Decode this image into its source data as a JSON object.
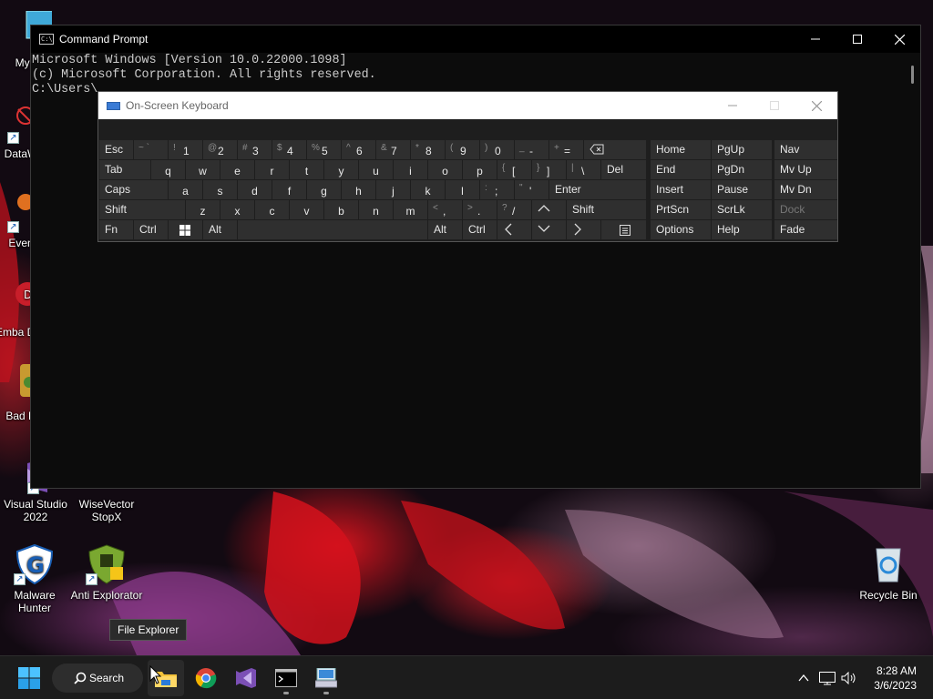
{
  "desktop": {
    "icons": [
      {
        "label": "My Co"
      },
      {
        "label": "DataW"
      },
      {
        "label": "Even"
      },
      {
        "label": "Emba Dev"
      },
      {
        "label": "Bad R"
      },
      {
        "label": "Visual Studio 2022"
      },
      {
        "label": "WiseVector StopX"
      },
      {
        "label": "Malware Hunter"
      },
      {
        "label": "Anti Explorator"
      },
      {
        "label": "Recycle Bin"
      }
    ]
  },
  "cmd": {
    "title": "Command Prompt",
    "lines": [
      "Microsoft Windows [Version 10.0.22000.1098]",
      "(c) Microsoft Corporation. All rights reserved.",
      "",
      "C:\\Users\\"
    ]
  },
  "osk": {
    "title": "On-Screen Keyboard",
    "row1": [
      {
        "label": "Esc"
      },
      {
        "sec": "~ `",
        "pri": ""
      },
      {
        "sec": "!",
        "pri": "1"
      },
      {
        "sec": "@",
        "pri": "2"
      },
      {
        "sec": "#",
        "pri": "3"
      },
      {
        "sec": "$",
        "pri": "4"
      },
      {
        "sec": "%",
        "pri": "5"
      },
      {
        "sec": "^",
        "pri": "6"
      },
      {
        "sec": "&",
        "pri": "7"
      },
      {
        "sec": "*",
        "pri": "8"
      },
      {
        "sec": "(",
        "pri": "9"
      },
      {
        "sec": ")",
        "pri": "0"
      },
      {
        "sec": "_",
        "pri": "-"
      },
      {
        "sec": "+",
        "pri": "="
      }
    ],
    "row2": [
      "Tab",
      "q",
      "w",
      "e",
      "r",
      "t",
      "y",
      "u",
      "i",
      "o",
      "p"
    ],
    "row2_brackets": [
      {
        "sec": "{",
        "pri": "["
      },
      {
        "sec": "}",
        "pri": "]"
      },
      {
        "sec": "|",
        "pri": "\\"
      }
    ],
    "row2_del": "Del",
    "row3": [
      "Caps",
      "a",
      "s",
      "d",
      "f",
      "g",
      "h",
      "j",
      "k",
      "l"
    ],
    "row3_punct": [
      {
        "sec": ":",
        "pri": ";"
      },
      {
        "sec": "\"",
        "pri": "'"
      }
    ],
    "row3_enter": "Enter",
    "row4": [
      "Shift",
      "z",
      "x",
      "c",
      "v",
      "b",
      "n",
      "m"
    ],
    "row4_punct": [
      {
        "sec": "<",
        "pri": ","
      },
      {
        "sec": ">",
        "pri": "."
      },
      {
        "sec": "?",
        "pri": "/"
      }
    ],
    "row4_shift_r": "Shift",
    "row5": {
      "fn": "Fn",
      "ctrl": "Ctrl",
      "alt": "Alt",
      "alt_r": "Alt",
      "ctrl_r": "Ctrl"
    },
    "nav": [
      [
        "Home",
        "PgUp",
        "Nav"
      ],
      [
        "End",
        "PgDn",
        "Mv Up"
      ],
      [
        "Insert",
        "Pause",
        "Mv Dn"
      ],
      [
        "PrtScn",
        "ScrLk",
        "Dock"
      ],
      [
        "Options",
        "Help",
        "Fade"
      ]
    ]
  },
  "tooltip": "File Explorer",
  "taskbar": {
    "search_label": "Search",
    "time": "8:28 AM",
    "date": "3/6/2023"
  }
}
